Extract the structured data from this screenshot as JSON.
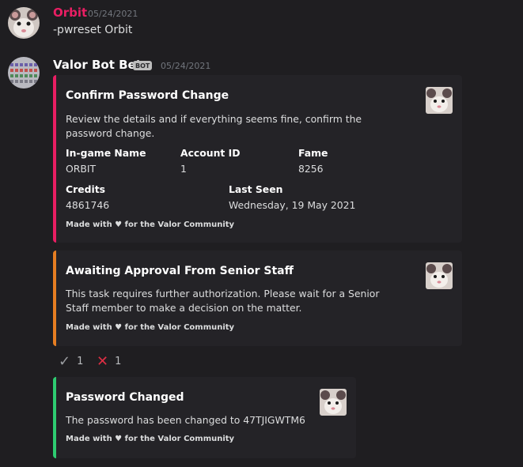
{
  "messages": {
    "user": {
      "username": "Orbit",
      "username_color": "#e91e63",
      "timestamp": "05/24/2021",
      "content": "-pwreset Orbit",
      "avatar_icon": "rat-avatar-icon"
    },
    "bot": {
      "username": "Valor Bot Beta",
      "badge": "BOT",
      "timestamp": "05/24/2021",
      "avatar_icon": "valor-bot-avatar-icon"
    }
  },
  "embeds": {
    "confirm": {
      "accent": "#e91e63",
      "title": "Confirm Password Change",
      "description": "Review the details and if everything seems fine, confirm the password change.",
      "fields": {
        "ign_name": "In-game Name",
        "ign_value": "ORBIT",
        "account_name": "Account ID",
        "account_value": "1",
        "fame_name": "Fame",
        "fame_value": "8256",
        "credits_name": "Credits",
        "credits_value": "4861746",
        "seen_name": "Last Seen",
        "seen_value": "Wednesday, 19 May 2021"
      },
      "footer": "Made with ♥ for the Valor Community"
    },
    "awaiting": {
      "accent": "#e67e22",
      "title": "Awaiting Approval From Senior Staff",
      "description": "This task requires further authorization. Please wait for a Senior Staff member to make a decision on the matter.",
      "footer": "Made with ♥ for the Valor Community"
    },
    "changed": {
      "accent": "#2ecc71",
      "title": "Password Changed",
      "description": "The password has been changed to 47TJIGWTM6",
      "footer": "Made with ♥ for the Valor Community"
    }
  },
  "reactions": {
    "approve": {
      "glyph": "✓",
      "count": "1",
      "icon": "checkmark-icon"
    },
    "deny": {
      "glyph": "✕",
      "count": "1",
      "icon": "cross-icon",
      "color": "#dd2e44"
    }
  }
}
